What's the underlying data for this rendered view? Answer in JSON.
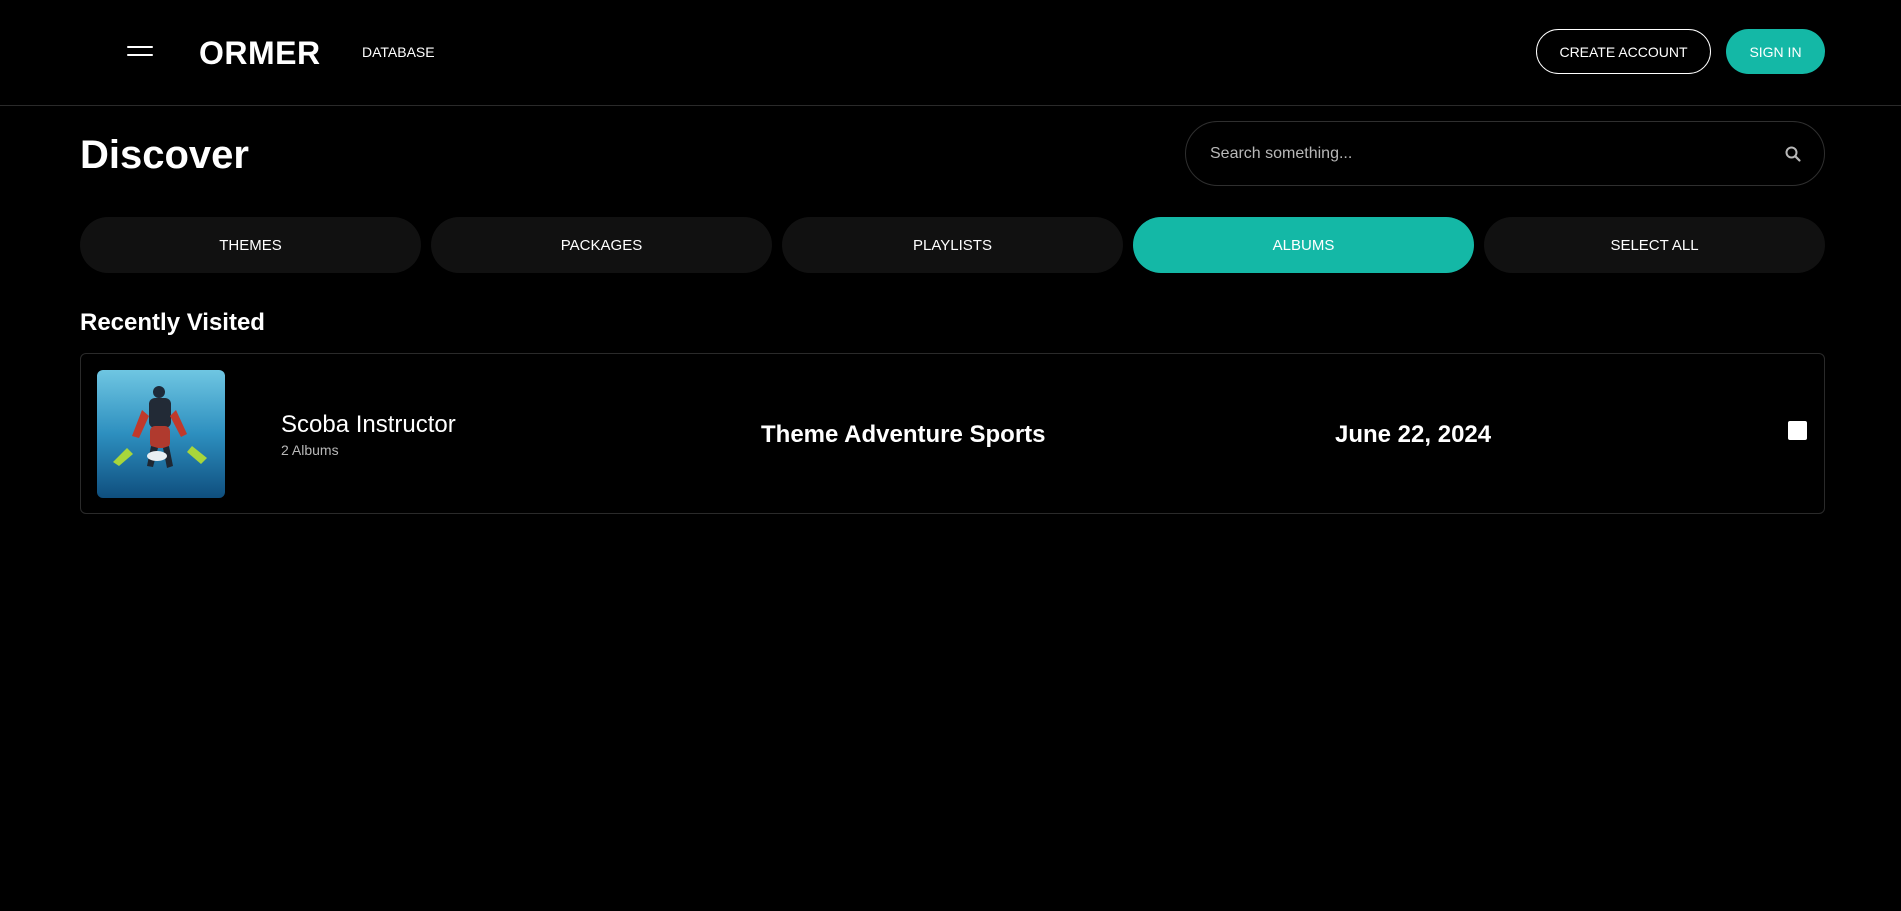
{
  "header": {
    "menu_icon": "hamburger-menu-icon",
    "logo": "ORMER",
    "nav_database": "DATABASE",
    "create_account": "CREATE ACCOUNT",
    "sign_in": "SIGN IN"
  },
  "page": {
    "title": "Discover"
  },
  "search": {
    "placeholder": "Search something...",
    "value": "",
    "icon": "search-icon"
  },
  "tabs": [
    {
      "label": "THEMES",
      "active": false
    },
    {
      "label": "PACKAGES",
      "active": false
    },
    {
      "label": "PLAYLISTS",
      "active": false
    },
    {
      "label": "ALBUMS",
      "active": true
    },
    {
      "label": "SELECT ALL",
      "active": false
    }
  ],
  "recent": {
    "title": "Recently Visited",
    "items": [
      {
        "name": "Scoba Instructor",
        "subtitle": "2 Albums",
        "theme": "Theme Adventure Sports",
        "date": "June 22, 2024",
        "checked": false
      }
    ]
  },
  "colors": {
    "accent": "#14b8a6",
    "background": "#000000",
    "tab_background": "#111111",
    "border": "#2a2a2a",
    "muted_text": "#b8b8b8"
  }
}
